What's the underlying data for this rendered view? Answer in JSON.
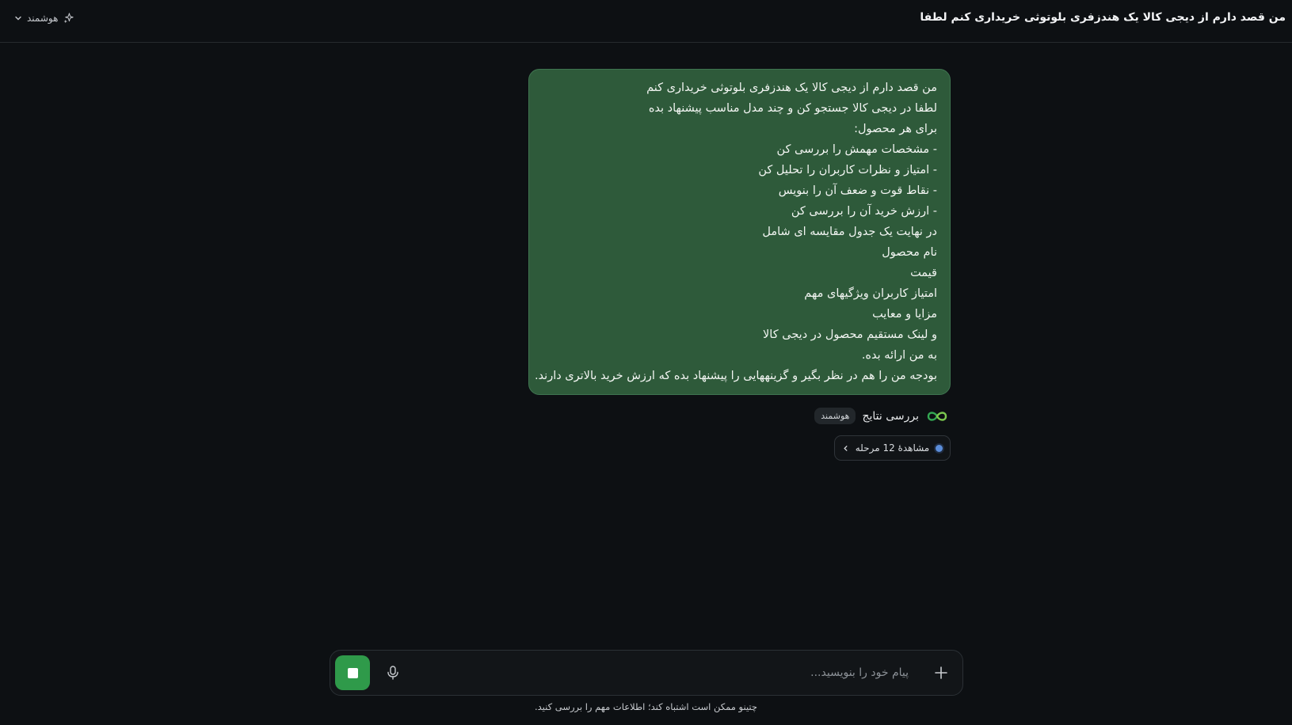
{
  "header": {
    "conversation_title": "من قصد دارم از دیجی کالا یک هندزفری بلوتوثی خریداری کنم لطفا",
    "model_label": "هوشمند"
  },
  "user_message": {
    "lines": [
      "من قصد دارم از دیجی کالا یک هندزفری بلوتوثی خریداری کنم",
      "لطفا در دیجی کالا جستجو کن و چند مدل مناسب پیشنهاد بده",
      "برای هر محصول:",
      "- مشخصات مهمش را بررسی کن",
      "- امتیاز و نظرات کاربران را تحلیل کن",
      "- نقاط قوت و ضعف آن را بنویس",
      "- ارزش خرید آن را بررسی کن",
      "در نهایت یک جدول مقایسه ای شامل",
      "نام محصول",
      "قیمت",
      "امتیاز کاربران ویژگیهای مهم",
      "مزایا و معایب",
      "و لینک مستقیم محصول در دیجی کالا",
      "به من ارائه بده.",
      "بودجه من را هم در نظر بگیر و گزینههایی را پیشنهاد بده که ارزش خرید بالاتری دارند."
    ]
  },
  "assistant": {
    "status": "بررسی نتایج",
    "mode_badge": "هوشمند",
    "steps_label": "مشاهدهٔ 12 مرحله"
  },
  "composer": {
    "placeholder": "پیام خود را بنویسید...",
    "value": ""
  },
  "footer": {
    "disclaimer": "چتینو ممکن است اشتباه کند؛ اطلاعات مهم را بررسی کنید."
  },
  "colors": {
    "background": "#0d1013",
    "user_bubble": "#2e5a3a",
    "accent_green": "#2f9a4a",
    "step_dot": "#5b8dd9"
  },
  "icons": {
    "model": "sparkle-icon",
    "model_chevron": "chevron-down-icon",
    "logo": "infinity-logo-icon",
    "steps_chevron": "chevron-left-icon",
    "mic": "microphone-icon",
    "stop": "stop-icon",
    "attach": "plus-icon"
  }
}
